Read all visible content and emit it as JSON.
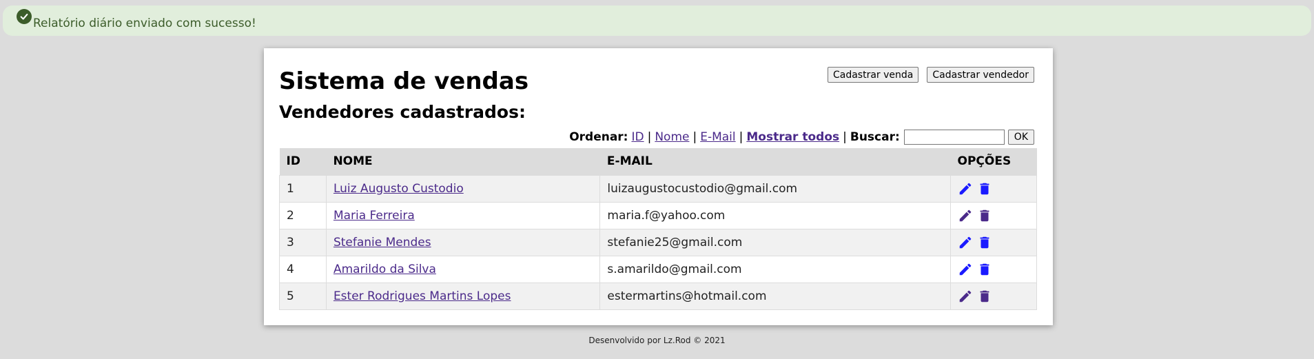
{
  "alert": {
    "message": "Relatório diário enviado com sucesso!",
    "icon": "check-circle-icon",
    "color": "#3c5c2a"
  },
  "header": {
    "title": "Sistema de vendas",
    "subtitle": "Vendedores cadastrados:",
    "buttons": {
      "new_sale": "Cadastrar venda",
      "new_seller": "Cadastrar vendedor"
    }
  },
  "toolbar": {
    "order_label": "Ordenar:",
    "order_id": "ID",
    "order_name": "Nome",
    "order_email": "E-Mail",
    "show_all": "Mostrar todos",
    "search_label": "Buscar:",
    "search_value": "",
    "ok_label": "OK"
  },
  "table": {
    "headers": {
      "id": "ID",
      "name": "NOME",
      "email": "E-MAIL",
      "options": "OPÇÕES"
    },
    "rows": [
      {
        "id": "1",
        "name": "Luiz Augusto Custodio",
        "email": "luizaugustocustodio@gmail.com",
        "edit_color": "#1a1aff",
        "delete_color": "#1a1aff"
      },
      {
        "id": "2",
        "name": "Maria Ferreira",
        "email": "maria.f@yahoo.com",
        "edit_color": "#4b2a8a",
        "delete_color": "#4b2a8a"
      },
      {
        "id": "3",
        "name": "Stefanie Mendes",
        "email": "stefanie25@gmail.com",
        "edit_color": "#1a1aff",
        "delete_color": "#1a1aff"
      },
      {
        "id": "4",
        "name": "Amarildo da Silva",
        "email": "s.amarildo@gmail.com",
        "edit_color": "#1a1aff",
        "delete_color": "#1a1aff"
      },
      {
        "id": "5",
        "name": "Ester Rodrigues Martins Lopes",
        "email": "estermartins@hotmail.com",
        "edit_color": "#4b2a8a",
        "delete_color": "#4b2a8a"
      }
    ]
  },
  "footer": {
    "text": "Desenvolvido por Lz.Rod © 2021"
  }
}
